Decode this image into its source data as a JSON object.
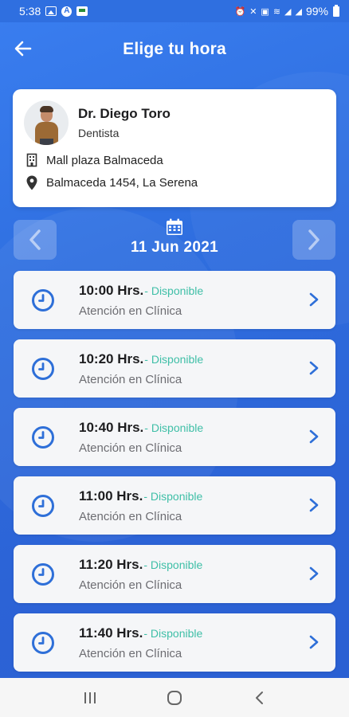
{
  "status_bar": {
    "time": "5:38",
    "battery": "99%"
  },
  "header": {
    "title": "Elige tu hora",
    "back_icon": "arrow-left-icon"
  },
  "doctor": {
    "name": "Dr. Diego Toro",
    "specialty": "Dentista",
    "clinic": "Mall plaza Balmaceda",
    "address": "Balmaceda 1454, La Serena"
  },
  "date_selector": {
    "date": "11 Jun 2021",
    "icon": "calendar-icon"
  },
  "slots": [
    {
      "time": "10:00 Hrs.",
      "status": "- Disponible",
      "type": "Atención en Clínica"
    },
    {
      "time": "10:20 Hrs.",
      "status": "- Disponible",
      "type": "Atención en Clínica"
    },
    {
      "time": "10:40 Hrs.",
      "status": "- Disponible",
      "type": "Atención en Clínica"
    },
    {
      "time": "11:00 Hrs.",
      "status": "- Disponible",
      "type": "Atención en Clínica"
    },
    {
      "time": "11:20 Hrs.",
      "status": "- Disponible",
      "type": "Atención en Clínica"
    },
    {
      "time": "11:40 Hrs.",
      "status": "- Disponible",
      "type": "Atención en Clínica"
    }
  ],
  "colors": {
    "primary": "#2f6fe0",
    "available": "#3fbfa7",
    "clock": "#2e6fd8"
  }
}
